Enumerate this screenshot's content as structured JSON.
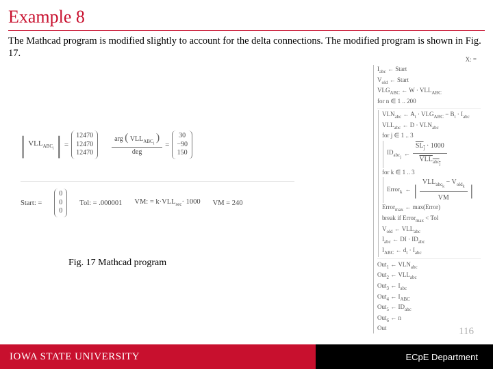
{
  "title": "Example 8",
  "body": "The Mathcad program is modified slightly to account for the delta connections. The modified program is shown in Fig. 17.",
  "fig_caption": "Fig. 17 Mathcad program",
  "page_num": "116",
  "footer": {
    "left": "IOWA STATE UNIVERSITY",
    "right": "ECpE Department"
  },
  "vll": {
    "label_lhs": "VLL",
    "label_sub": "ABC",
    "label_idx": "i",
    "mag": [
      "12470",
      "12470",
      "12470"
    ],
    "arg_label": "arg",
    "arg_arg_label": "VLL",
    "arg_sub": "ABC",
    "deg_label": "deg",
    "ang": [
      "30",
      "−90",
      "150"
    ]
  },
  "start": {
    "label": "Start: =",
    "vec": [
      "0",
      "0",
      "0"
    ],
    "tol_label": "Tol: =",
    "tol": ".000001",
    "vm_label": "VM: =",
    "vm_expr": "k·VLL",
    "vm_sub": "sec",
    "vm_tail": "· 1000",
    "vm2_label": "VM =",
    "vm2": "240"
  },
  "prog": {
    "header": "X: =",
    "l1": "I",
    "l1s": "abc",
    "l1r": "← Start",
    "l2": "V",
    "l2s": "old",
    "l2r": "← Start",
    "l3": "VLG",
    "l3s": "ABC",
    "l3r": "← W · VLL",
    "l3s2": "ABC",
    "l4": "for n ∈ 1 .. 200",
    "l5": "VLN",
    "l5s": "abc",
    "l5r": "← A",
    "l5s2": "t",
    "l5r2": " · VLG",
    "l5s3": "ABC",
    "l5r3": " − B",
    "l5s4": "t",
    "l5r4": " · I",
    "l5s5": "abc",
    "l6": "VLL",
    "l6s": "abc",
    "l6r": "← D · VLN",
    "l6s2": "abc",
    "l7": "for j ∈ 1 .. 3",
    "l8": "ID",
    "l8s": "abc",
    "l8i": "j",
    "l8r": "←",
    "l8num": "SL",
    "l8numS": "j",
    "l8numR": " · 1000",
    "l8den": "VLL",
    "l8denS": "abc",
    "l8denI": "j",
    "l9": "for k ∈ 1 .. 3",
    "l10": "Error",
    "l10s": "k",
    "l10r": "←",
    "l10num": "VLL",
    "l10numS": "abc",
    "l10numI": "k",
    "l10numR": " − V",
    "l10numS2": "old",
    "l10numI2": "k",
    "l10den": "VM",
    "l11": "Error",
    "l11s": "max",
    "l11r": "← max(Error)",
    "l12": "break if Error",
    "l12s": "max",
    "l12r": " < Tol",
    "l13": "V",
    "l13s": "old",
    "l13r": "← VLL",
    "l13s2": "abc",
    "l14": "I",
    "l14s": "abc",
    "l14r": "← DI · ID",
    "l14s2": "abc",
    "l15": "I",
    "l15s": "ABC",
    "l15r": "← d",
    "l15s2": "t",
    "l15r2": " · I",
    "l15s3": "abc",
    "o1": "Out",
    "o1s": "1",
    "o1r": "← VLN",
    "o1s2": "abc",
    "o2": "Out",
    "o2s": "2",
    "o2r": "← VLL",
    "o2s2": "abc",
    "o3": "Out",
    "o3s": "3",
    "o3r": "← I",
    "o3s2": "abc",
    "o4": "Out",
    "o4s": "4",
    "o4r": "← I",
    "o4s2": "ABC",
    "o5": "Out",
    "o5s": "5",
    "o5r": "← ID",
    "o5s2": "abc",
    "o6": "Out",
    "o6s": "6",
    "o6r": "← n",
    "o7": "Out"
  }
}
